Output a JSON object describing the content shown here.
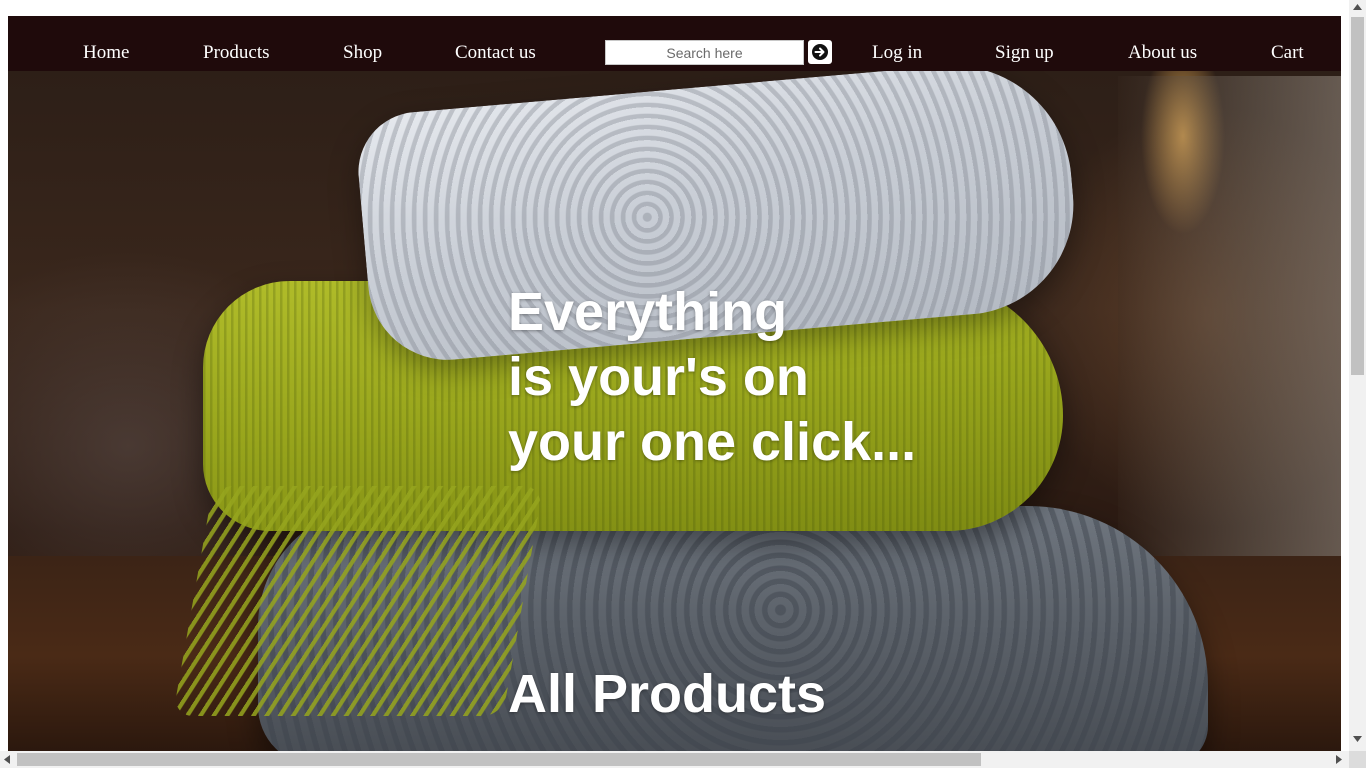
{
  "nav": {
    "home": "Home",
    "products": "Products",
    "shop": "Shop",
    "contact": "Contact us",
    "login": "Log in",
    "signup": "Sign up",
    "about": "About us",
    "cart": "Cart"
  },
  "search": {
    "placeholder": "Search here",
    "value": "",
    "button_icon": "arrow-right-icon"
  },
  "hero": {
    "heading_lines": [
      "Everything",
      "is your's on",
      "your one click..."
    ],
    "background_icon": "stacked-knit-scarves-image"
  },
  "section": {
    "title": "All Products"
  },
  "colors": {
    "navbar_bg": "#1f0a0b",
    "nav_text": "#ffffff",
    "hero_text": "#ffffff"
  }
}
